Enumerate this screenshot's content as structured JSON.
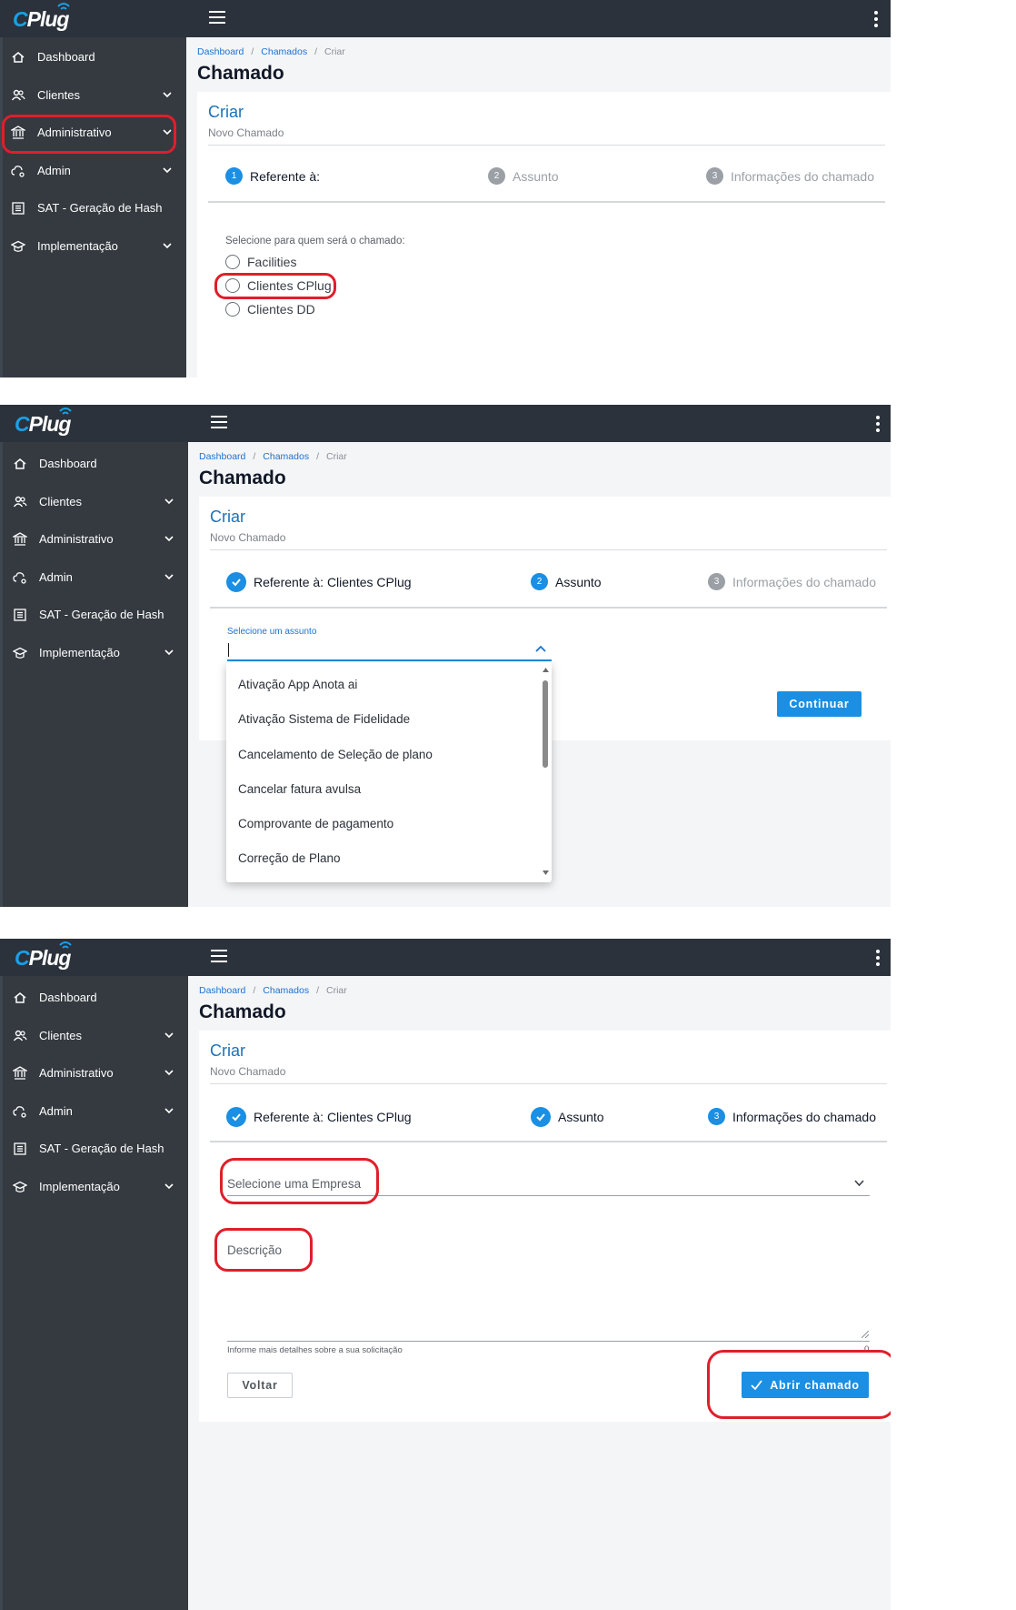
{
  "app": {
    "logo_text_c": "C",
    "logo_text_rest": "Plug"
  },
  "sidebar": {
    "items": [
      {
        "label": "Dashboard",
        "icon": "home-icon",
        "has_chevron": false
      },
      {
        "label": "Clientes",
        "icon": "users-icon",
        "has_chevron": true
      },
      {
        "label": "Administrativo",
        "icon": "bank-icon",
        "has_chevron": true
      },
      {
        "label": "Admin",
        "icon": "cloud-settings-icon",
        "has_chevron": true
      },
      {
        "label": "SAT - Geração de Hash",
        "icon": "list-icon",
        "has_chevron": false
      },
      {
        "label": "Implementação",
        "icon": "graduation-cap-icon",
        "has_chevron": true
      }
    ]
  },
  "breadcrumb": {
    "dashboard": "Dashboard",
    "chamados": "Chamados",
    "current": "Criar"
  },
  "page_title": "Chamado",
  "card": {
    "title": "Criar",
    "subtitle": "Novo Chamado"
  },
  "panel1": {
    "steps": [
      {
        "num": "1",
        "label": "Referente à:"
      },
      {
        "num": "2",
        "label": "Assunto"
      },
      {
        "num": "3",
        "label": "Informações do chamado"
      }
    ],
    "prompt": "Selecione para quem será o chamado:",
    "options": [
      "Facilities",
      "Clientes CPlug",
      "Clientes DD"
    ]
  },
  "panel2": {
    "steps": [
      {
        "num": "",
        "label": "Referente à: Clientes CPlug"
      },
      {
        "num": "2",
        "label": "Assunto"
      },
      {
        "num": "3",
        "label": "Informações do chamado"
      }
    ],
    "select_label": "Selecione um assunto",
    "continue_label": "Continuar",
    "options": [
      "Ativação App Anota ai",
      "Ativação Sistema de Fidelidade",
      "Cancelamento de Seleção de plano",
      "Cancelar fatura avulsa",
      "Comprovante de pagamento",
      "Correção de Plano"
    ]
  },
  "panel3": {
    "steps": [
      {
        "num": "",
        "label": "Referente à: Clientes CPlug"
      },
      {
        "num": "",
        "label": "Assunto"
      },
      {
        "num": "3",
        "label": "Informações do chamado"
      }
    ],
    "company_placeholder": "Selecione uma Empresa",
    "description_placeholder": "Descrição",
    "description_hint": "Informe mais detalhes sobre a sua solicitação",
    "char_count": "0",
    "back_label": "Voltar",
    "submit_label": "Abrir chamado"
  },
  "colors": {
    "topbar": "#2b323b",
    "sidebar": "#343a40",
    "accent": "#1a8fe3",
    "highlight": "#e01e2b"
  }
}
